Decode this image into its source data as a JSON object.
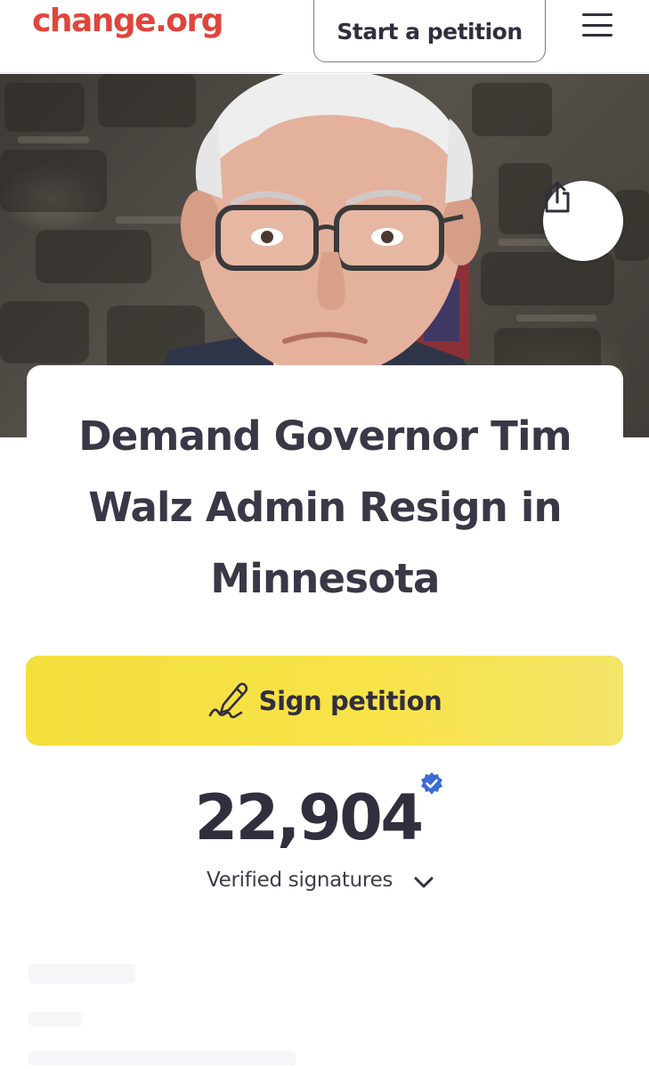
{
  "header": {
    "logo_text": "change.org",
    "start_petition_label": "Start a petition",
    "menu_icon": "hamburger-menu-icon"
  },
  "hero": {
    "share_icon": "share-icon"
  },
  "petition": {
    "title": "Demand Governor Tim Walz Admin Resign in Minnesota",
    "sign_label": "Sign petition",
    "sign_icon": "signature-pen-icon",
    "signature_count": "22,904",
    "verified_label": "Verified signatures",
    "verified_icon": "verified-badge-icon",
    "expand_icon": "chevron-down-icon"
  },
  "colors": {
    "brand": "#e0453c",
    "sign_button": "#f8e34a",
    "text": "#312e3e",
    "verified_badge": "#3b6bd8"
  }
}
